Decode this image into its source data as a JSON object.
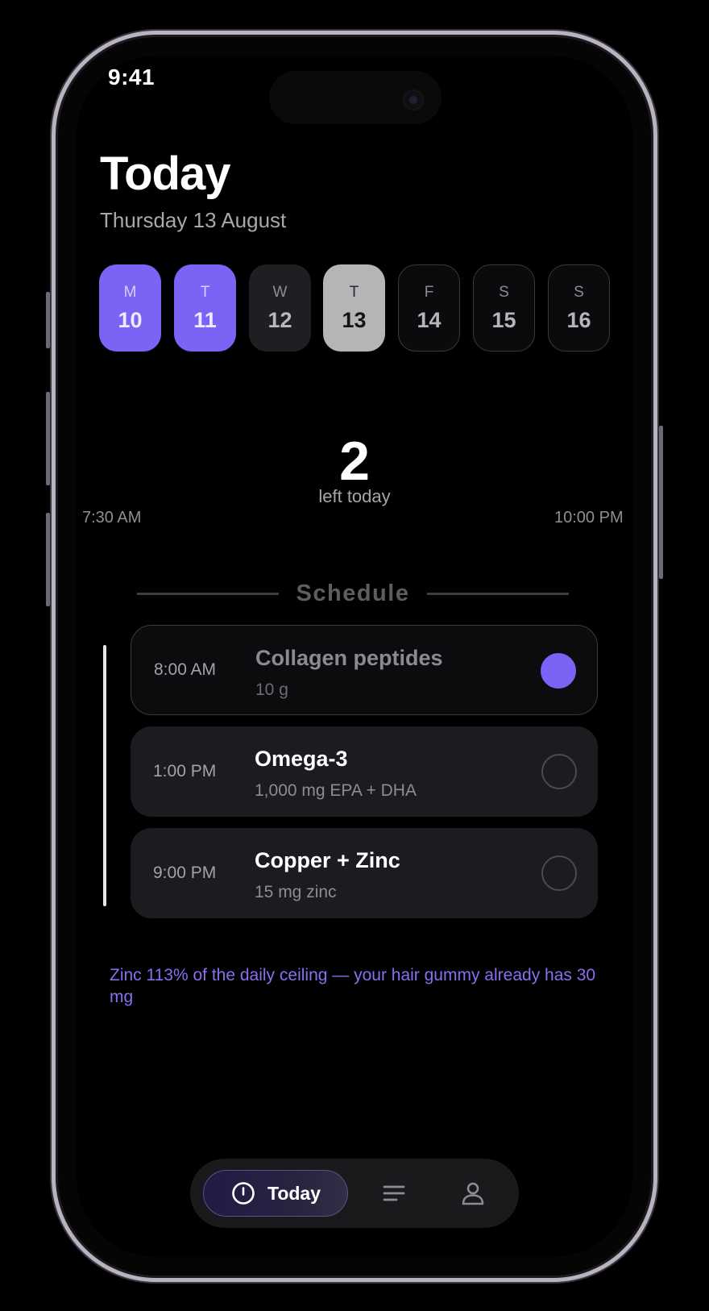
{
  "status_bar": {
    "time": "9:41"
  },
  "header": {
    "title": "Today",
    "date": "Thursday 13 August"
  },
  "week": [
    {
      "letter": "M",
      "day": "10",
      "state": "done"
    },
    {
      "letter": "T",
      "day": "11",
      "state": "done"
    },
    {
      "letter": "W",
      "day": "12",
      "state": "past"
    },
    {
      "letter": "T",
      "day": "13",
      "state": "today"
    },
    {
      "letter": "F",
      "day": "14",
      "state": "future"
    },
    {
      "letter": "S",
      "day": "15",
      "state": "future"
    },
    {
      "letter": "S",
      "day": "16",
      "state": "future"
    }
  ],
  "progress": {
    "remaining": "2",
    "remaining_label": "left today",
    "start_time": "7:30 AM",
    "end_time": "10:00 PM",
    "taken_count": 1,
    "total_count": 3,
    "accent": "#7b63f5"
  },
  "schedule": {
    "title": "Schedule",
    "items": [
      {
        "time": "8:00 AM",
        "name": "Collagen peptides",
        "dose": "10 g",
        "taken": true
      },
      {
        "time": "1:00 PM",
        "name": "Omega-3",
        "dose": "1,000 mg EPA + DHA",
        "taken": false
      },
      {
        "time": "9:00 PM",
        "name": "Copper + Zinc",
        "dose": "15 mg zinc",
        "taken": false
      }
    ]
  },
  "warning": "Zinc 113% of the daily ceiling — your hair gummy already has 30 mg",
  "tabbar": {
    "items": [
      {
        "label": "Today",
        "icon": "clock-icon",
        "active": true
      },
      {
        "label": "",
        "icon": "list-icon",
        "active": false
      },
      {
        "label": "",
        "icon": "profile-icon",
        "active": false
      }
    ]
  }
}
